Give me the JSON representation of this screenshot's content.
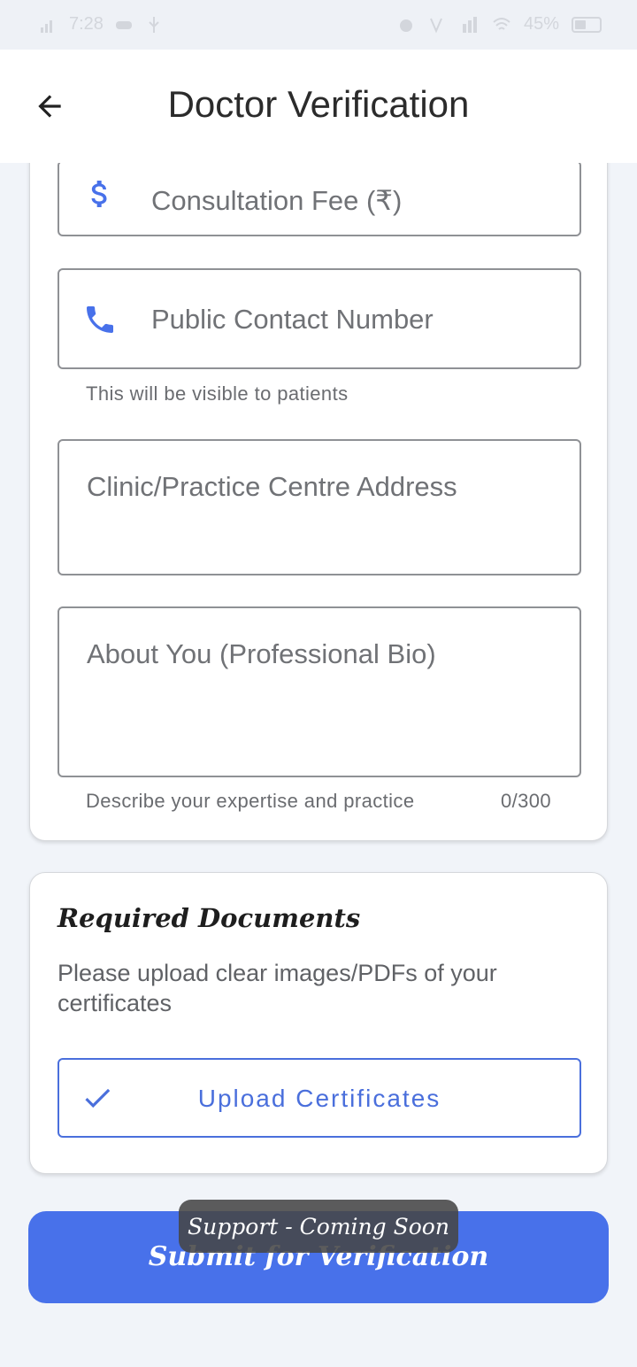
{
  "status_bar": {
    "time": "7:28",
    "battery": "45%"
  },
  "app_bar": {
    "title": "Doctor Verification",
    "back_icon": "arrow-left-icon"
  },
  "form": {
    "consultation_fee": {
      "placeholder": "Consultation Fee (₹)",
      "icon": "dollar-icon"
    },
    "contact_number": {
      "placeholder": "Public Contact Number",
      "icon": "phone-icon",
      "helper": "This will be visible to patients"
    },
    "address": {
      "placeholder": "Clinic/Practice Centre Address"
    },
    "bio": {
      "placeholder": "About You (Professional Bio)",
      "helper": "Describe your expertise and practice",
      "counter": "0/300"
    }
  },
  "documents": {
    "title": "Required Documents",
    "description": "Please upload clear images/PDFs of your certificates",
    "upload_label": "Upload Certificates",
    "upload_icon": "check-icon"
  },
  "submit_label": "Submit for Verification",
  "toast": "Support - Coming Soon",
  "colors": {
    "accent": "#4871ea",
    "outline_accent": "#4a6fdc",
    "background": "#f1f4f9"
  }
}
